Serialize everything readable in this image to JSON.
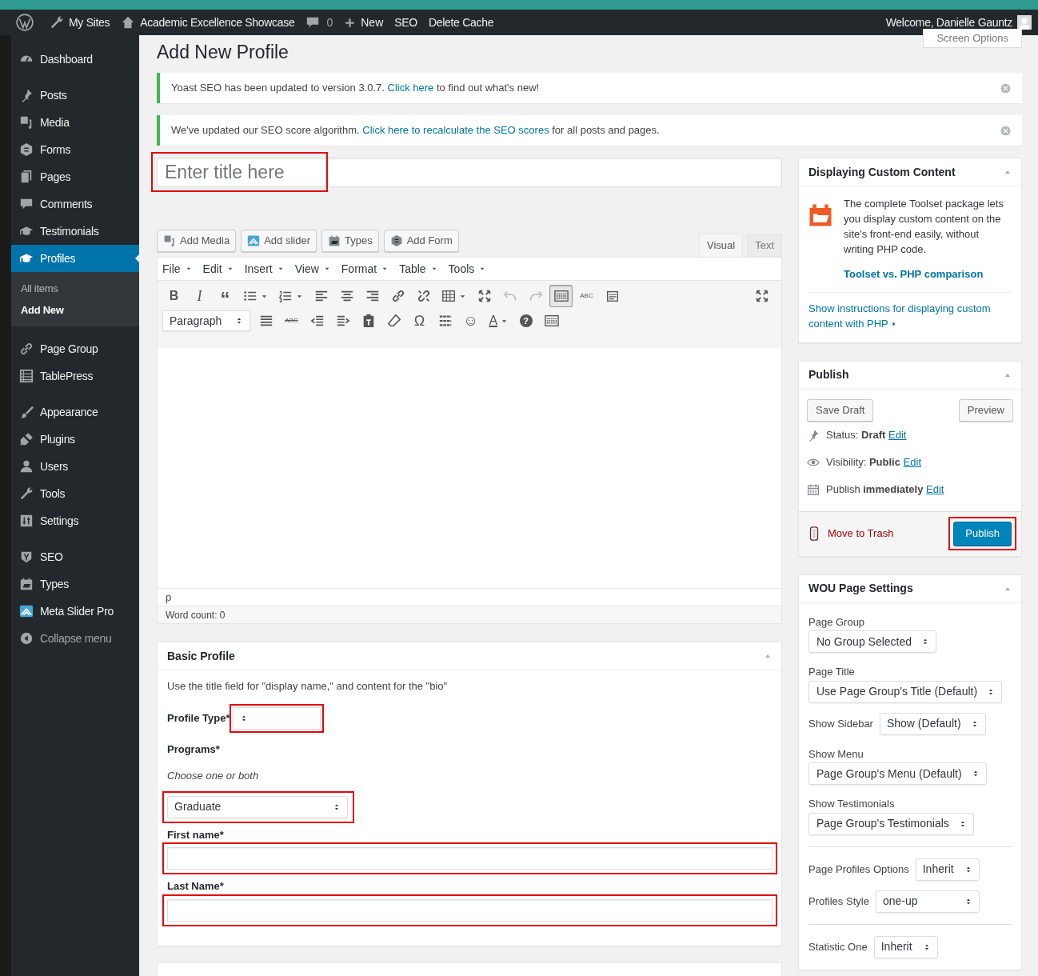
{
  "admin_bar": {
    "items": [
      {
        "kind": "logo"
      },
      {
        "kind": "sites",
        "label": "My Sites"
      },
      {
        "kind": "home",
        "label": "Academic Excellence Showcase"
      },
      {
        "kind": "comments",
        "label": "0"
      },
      {
        "kind": "new",
        "label": "New"
      },
      {
        "kind": "text",
        "label": "SEO"
      },
      {
        "kind": "text",
        "label": "Delete Cache"
      }
    ],
    "greeting": "Welcome, Danielle Gauntz"
  },
  "sidebar": {
    "groups": [
      [
        {
          "label": "Dashboard",
          "selected": false
        }
      ],
      [
        {
          "label": "Posts",
          "selected": false
        },
        {
          "label": "Media",
          "selected": false
        },
        {
          "label": "Forms",
          "selected": false
        },
        {
          "label": "Pages",
          "selected": false
        },
        {
          "label": "Comments",
          "selected": false
        },
        {
          "label": "Testimonials",
          "selected": false
        },
        {
          "label": "Profiles",
          "selected": true,
          "children": [
            {
              "label": "All items",
              "selected": false
            },
            {
              "label": "Add New",
              "selected": true
            }
          ]
        }
      ],
      [
        {
          "label": "Page Group",
          "selected": false
        },
        {
          "label": "TablePress",
          "selected": false
        }
      ],
      [
        {
          "label": "Appearance",
          "selected": false
        },
        {
          "label": "Plugins",
          "selected": false
        },
        {
          "label": "Users",
          "selected": false
        },
        {
          "label": "Tools",
          "selected": false
        },
        {
          "label": "Settings",
          "selected": false
        }
      ],
      [
        {
          "label": "SEO",
          "selected": false
        },
        {
          "label": "Types",
          "selected": false
        },
        {
          "label": "Meta Slider Pro",
          "selected": false
        }
      ]
    ],
    "collapse": "Collapse menu"
  },
  "page_title": "Add New Profile",
  "screen_options": "Screen Options",
  "notices": [
    {
      "before": "Yoast SEO has been updated to version 3.0.7. ",
      "link": "Click here",
      "after": " to find out what's new!"
    },
    {
      "before": "We've updated our SEO score algorithm. ",
      "link": "Click here to recalculate the SEO scores",
      "after": " for all posts and pages."
    }
  ],
  "title_field": {
    "placeholder": "Enter title here",
    "highlighted": true
  },
  "media_buttons": [
    "Add Media",
    "Add slider",
    "Types",
    "Add Form"
  ],
  "editor_tabs": [
    {
      "label": "Visual",
      "selected": true
    },
    {
      "label": "Text",
      "selected": false
    }
  ],
  "editor_menu": [
    "File",
    "Edit",
    "Insert",
    "View",
    "Format",
    "Table",
    "Tools"
  ],
  "toolbar_rows": [
    [
      {
        "glyph": "B",
        "kind": "bold"
      },
      {
        "glyph": "I",
        "kind": "italic"
      },
      {
        "glyph": "“",
        "kind": "quote"
      },
      {
        "kind": "bullets",
        "caret": true
      },
      {
        "kind": "numbers",
        "caret": true
      },
      {
        "kind": "align-left"
      },
      {
        "kind": "align-center"
      },
      {
        "kind": "align-right"
      },
      {
        "kind": "link"
      },
      {
        "kind": "unlink"
      },
      {
        "kind": "table",
        "caret": true
      },
      {
        "kind": "expand"
      },
      {
        "kind": "undo",
        "disabled": true
      },
      {
        "kind": "redo",
        "disabled": true
      },
      {
        "kind": "keyboard",
        "pressed": true
      },
      {
        "glyph": "ABC",
        "kind": "spellcheck"
      },
      {
        "kind": "paste"
      }
    ],
    [
      {
        "kind": "select",
        "value": "Paragraph"
      },
      {
        "kind": "justify"
      },
      {
        "glyph": "ABC",
        "kind": "strike"
      },
      {
        "kind": "outdent"
      },
      {
        "kind": "indent"
      },
      {
        "kind": "clipboard"
      },
      {
        "kind": "eraser"
      },
      {
        "glyph": "Ω",
        "kind": "omega"
      },
      {
        "kind": "hr"
      },
      {
        "glyph": "☺",
        "kind": "smile"
      },
      {
        "glyph": "A",
        "kind": "color",
        "caret": true
      },
      {
        "glyph": "?",
        "kind": "help"
      },
      {
        "kind": "keyboard",
        "pressed": false
      }
    ]
  ],
  "editor_status": {
    "path": "p",
    "word_count": "Word count: 0"
  },
  "basic_profile": {
    "title": "Basic Profile",
    "description": "Use the title field for \"display name,\" and content for the \"bio\"",
    "fields": [
      {
        "kind": "inline-select",
        "label": "Profile Type*",
        "highlighted": true
      },
      {
        "kind": "heading",
        "label": "Programs*"
      },
      {
        "kind": "note",
        "label": "Choose one or both"
      },
      {
        "kind": "select",
        "value": "Graduate",
        "highlighted": true
      },
      {
        "kind": "text",
        "label": "First name*",
        "highlighted": true
      },
      {
        "kind": "text",
        "label": "Last Name*",
        "highlighted": true
      }
    ]
  },
  "custom_content": {
    "title": "Displaying Custom Content",
    "body": "The complete Toolset package lets you display custom content on the site's front-end easily, without writing PHP code.",
    "link": "Toolset vs. PHP comparison",
    "instructions": "Show instructions for displaying custom content with PHP"
  },
  "publish": {
    "title": "Publish",
    "save_draft": "Save Draft",
    "preview": "Preview",
    "rows": [
      {
        "text": "Status: **Draft**",
        "link": "Edit"
      },
      {
        "text": "Visibility: **Public**",
        "link": "Edit"
      },
      {
        "text": "Publish **immediately**",
        "link": "Edit"
      }
    ],
    "trash": "Move to Trash",
    "button": "Publish",
    "highlighted": true
  },
  "page_settings": {
    "title": "WOU Page Settings",
    "rows": [
      {
        "kind": "stacked",
        "label": "Page Group",
        "value": "No Group Selected",
        "divider_before": false
      },
      {
        "kind": "stacked",
        "label": "Page Title",
        "value": "Use Page Group's Title (Default)",
        "divider_before": false
      },
      {
        "kind": "inline",
        "label": "Show Sidebar",
        "value": "Show (Default)",
        "divider_before": false
      },
      {
        "kind": "stacked",
        "label": "Show Menu",
        "value": "Page Group's Menu (Default)",
        "divider_before": false
      },
      {
        "kind": "stacked",
        "label": "Show Testimonials",
        "value": "Page Group's Testimonials",
        "divider_before": false
      },
      {
        "kind": "inline",
        "label": "Page Profiles Options",
        "value": "Inherit",
        "divider_before": true
      },
      {
        "kind": "inline",
        "label": "Profiles Style",
        "value": "one-up",
        "divider_before": false
      },
      {
        "kind": "inline",
        "label": "Statistic One",
        "value": "Inherit",
        "divider_before": true
      }
    ]
  }
}
